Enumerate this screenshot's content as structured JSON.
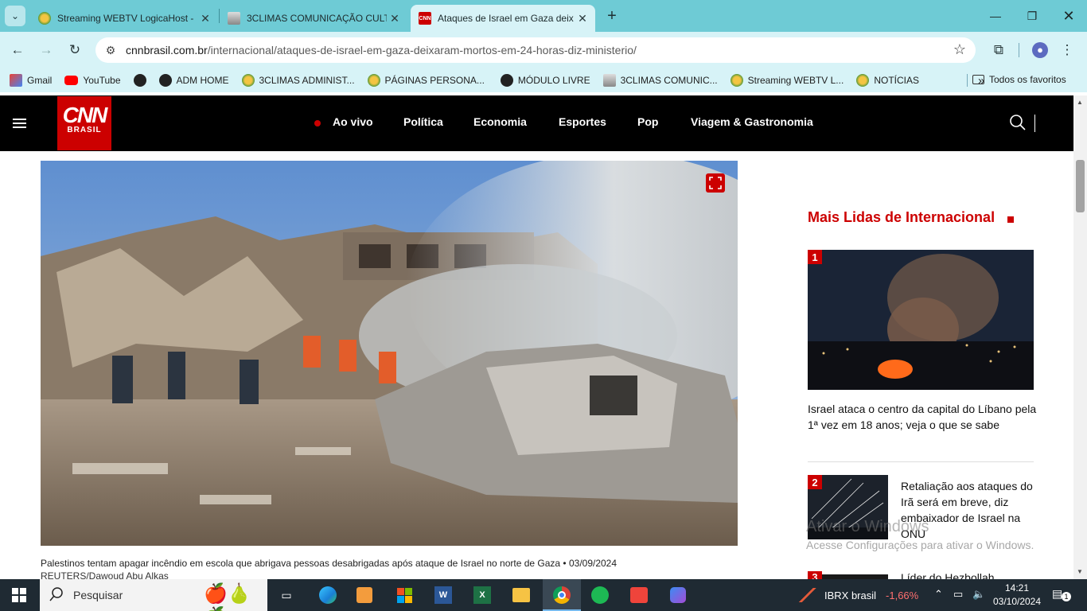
{
  "browser": {
    "tabs": [
      {
        "title": "Streaming WEBTV LogicaHost -",
        "icon": "globe-icon",
        "active": false
      },
      {
        "title": "3CLIMAS COMUNICAÇÃO CULT",
        "icon": "film-icon",
        "active": false
      },
      {
        "title": "Ataques de Israel em Gaza deix",
        "icon": "cnn-icon",
        "active": true
      }
    ],
    "url_domain": "cnnbrasil.com.br",
    "url_path": "/internacional/ataques-de-israel-em-gaza-deixaram-mortos-em-24-horas-diz-ministerio/",
    "bookmarks": [
      {
        "label": "Gmail",
        "icon": "gmail-icon"
      },
      {
        "label": "YouTube",
        "icon": "youtube-icon"
      },
      {
        "label": "",
        "icon": "globe-icon"
      },
      {
        "label": "ADM HOME",
        "icon": "globe-icon"
      },
      {
        "label": "3CLIMAS ADMINIST...",
        "icon": "globe-icon"
      },
      {
        "label": "PÁGINAS PERSONA...",
        "icon": "globe-icon"
      },
      {
        "label": "MÓDULO LIVRE",
        "icon": "globe-icon"
      },
      {
        "label": "3CLIMAS COMUNIC...",
        "icon": "film-icon"
      },
      {
        "label": "Streaming WEBTV L...",
        "icon": "globe-icon"
      },
      {
        "label": "NOTÍCIAS",
        "icon": "globe-icon"
      }
    ],
    "bookmarks_more": "»",
    "all_favorites": "Todos os favoritos"
  },
  "site": {
    "logo_text": "CNN",
    "logo_sub": "BRASIL",
    "nav": [
      "Ao vivo",
      "Política",
      "Economia",
      "Esportes",
      "Pop",
      "Viagem & Gastronomia"
    ]
  },
  "article": {
    "caption": "Palestinos tentam apagar incêndio em escola que abrigava pessoas desabrigadas após ataque de Israel no norte de Gaza • 03/09/2024",
    "credit": "REUTERS/Dawoud Abu Alkas"
  },
  "sidebar": {
    "title": "Mais Lidas de Internacional",
    "items": [
      {
        "rank": "1",
        "title": "Israel ataca o centro da capital do Líbano pela 1ª vez em 18 anos; veja o que se sabe"
      },
      {
        "rank": "2",
        "title": "Retaliação aos ataques do Irã será em breve, diz embaixador de Israel na ONU"
      },
      {
        "rank": "3",
        "title": "Líder do Hezbollah"
      }
    ]
  },
  "watermark": {
    "line1": "Ativar o Windows",
    "line2": "Acesse Configurações para ativar o Windows."
  },
  "taskbar": {
    "search_placeholder": "Pesquisar",
    "ticker_name": "IBRX brasil",
    "ticker_change": "-1,66%",
    "time": "14:21",
    "date": "03/10/2024",
    "notifications": "1"
  },
  "colors": {
    "accent": "#cc0000",
    "tabbar": "#6ecbd5",
    "toolbar": "#d7f3f7"
  }
}
